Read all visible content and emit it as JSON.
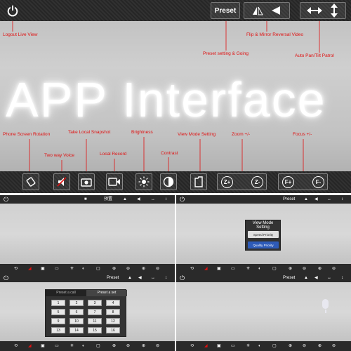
{
  "main": {
    "big_text": "APP Interface",
    "topbar": {
      "logout_icon": "power-icon",
      "preset_label": "Preset",
      "flip_icons": [
        "flip-vertical-icon",
        "mirror-left-icon"
      ],
      "pan_icons": [
        "arrow-left-right-icon",
        "arrow-up-down-icon"
      ]
    },
    "annotations": {
      "logout": "Logout Live View",
      "flip": "Flip & Mirror Reversal Video",
      "preset": "Preset setting & Going",
      "autopan": "Auto Pan/Tilt Patrol",
      "rotation": "Phone Screen Rotation",
      "voice": "Two way Voice",
      "snapshot": "Take Local Snapshot",
      "record": "Local Record",
      "brightness": "Brightness",
      "contrast": "Contrast",
      "viewmode": "View Mode Setting",
      "zoom": "Zoom +/-",
      "focus": "Focus +/-"
    },
    "bottombar": {
      "zoom_in": "Z+",
      "zoom_out": "Z-",
      "focus_in": "F+",
      "focus_out": "F-"
    },
    "accent_color": "#e01010"
  },
  "panels": {
    "preset_label": "Preset",
    "top_left_title": "预置",
    "view_mode": {
      "title": "View Mode Setting",
      "speed": "Speed Priority",
      "quality": "Quality Priority"
    },
    "preset_grid": {
      "tab_call": "Preset a call",
      "tab_set": "Preset a set",
      "numbers": [
        "1",
        "2",
        "3",
        "4",
        "5",
        "6",
        "7",
        "8",
        "9",
        "10",
        "11",
        "12",
        "13",
        "14",
        "15",
        "16"
      ]
    },
    "bottom_icons": [
      "Z+",
      "Z-",
      "F+",
      "F-"
    ]
  }
}
